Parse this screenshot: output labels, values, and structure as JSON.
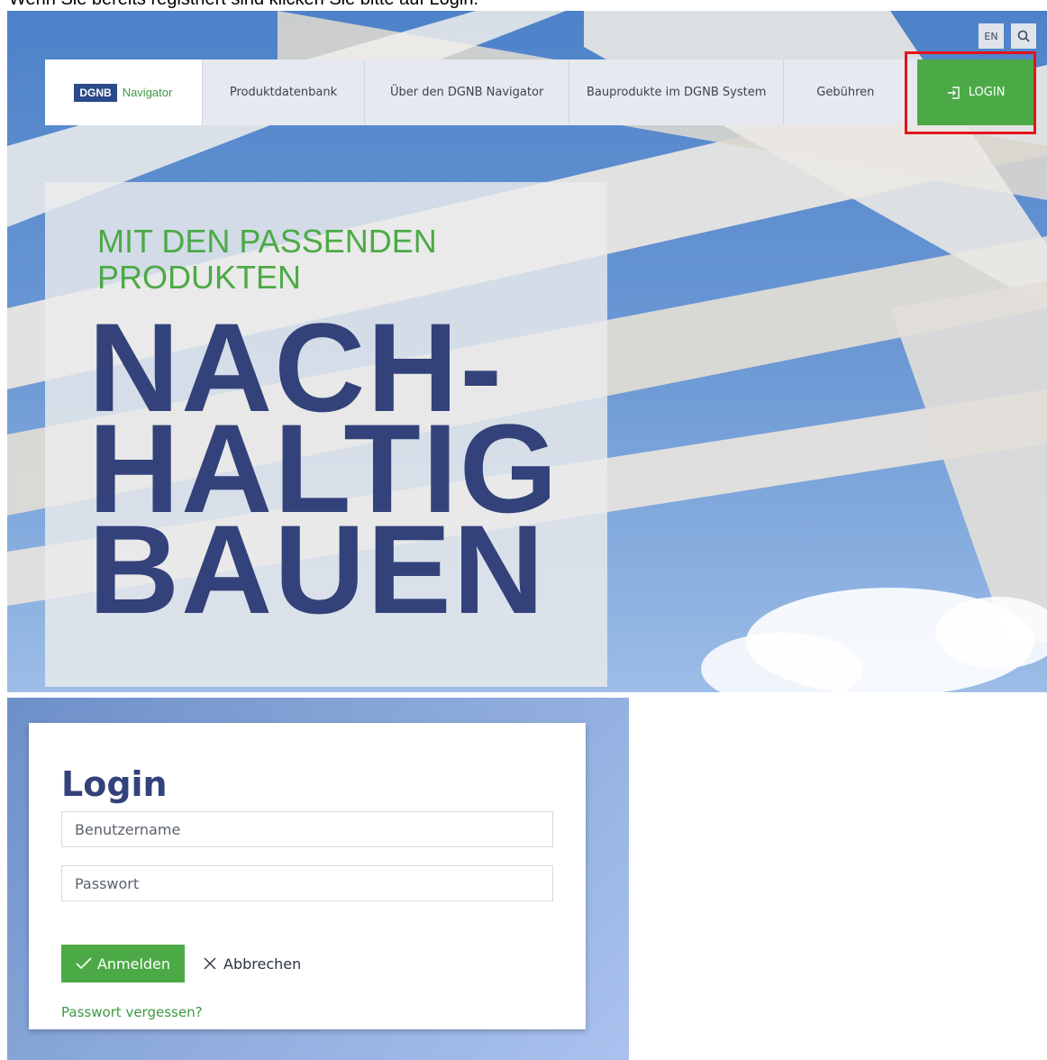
{
  "instruction_text": "Wenn Sie bereits registriert sind klicken Sie bitte auf Login.",
  "hero": {
    "utils": {
      "lang_label": "EN",
      "search_icon": "search-icon"
    },
    "logo": {
      "badge": "DGNB",
      "text": "Navigator"
    },
    "nav": [
      "Produktdatenbank",
      "Über den DGNB Navigator",
      "Bauprodukte im DGNB System",
      "Gebühren"
    ],
    "login_label": "LOGIN",
    "login_icon": "login-icon",
    "subtitle_line1": "MIT DEN PASSENDEN",
    "subtitle_line2": "PRODUKTEN",
    "big_line1": "NACH-",
    "big_line2": "HALTIG",
    "big_line3": "BAUEN"
  },
  "login": {
    "title": "Login",
    "username_placeholder": "Benutzername",
    "password_placeholder": "Passwort",
    "submit_label": "Anmelden",
    "cancel_label": "Abbrechen",
    "forgot_label": "Passwort vergessen?"
  },
  "colors": {
    "brand_green": "#4caa46",
    "brand_navy": "#33427a",
    "highlight_red": "#e4141b"
  }
}
